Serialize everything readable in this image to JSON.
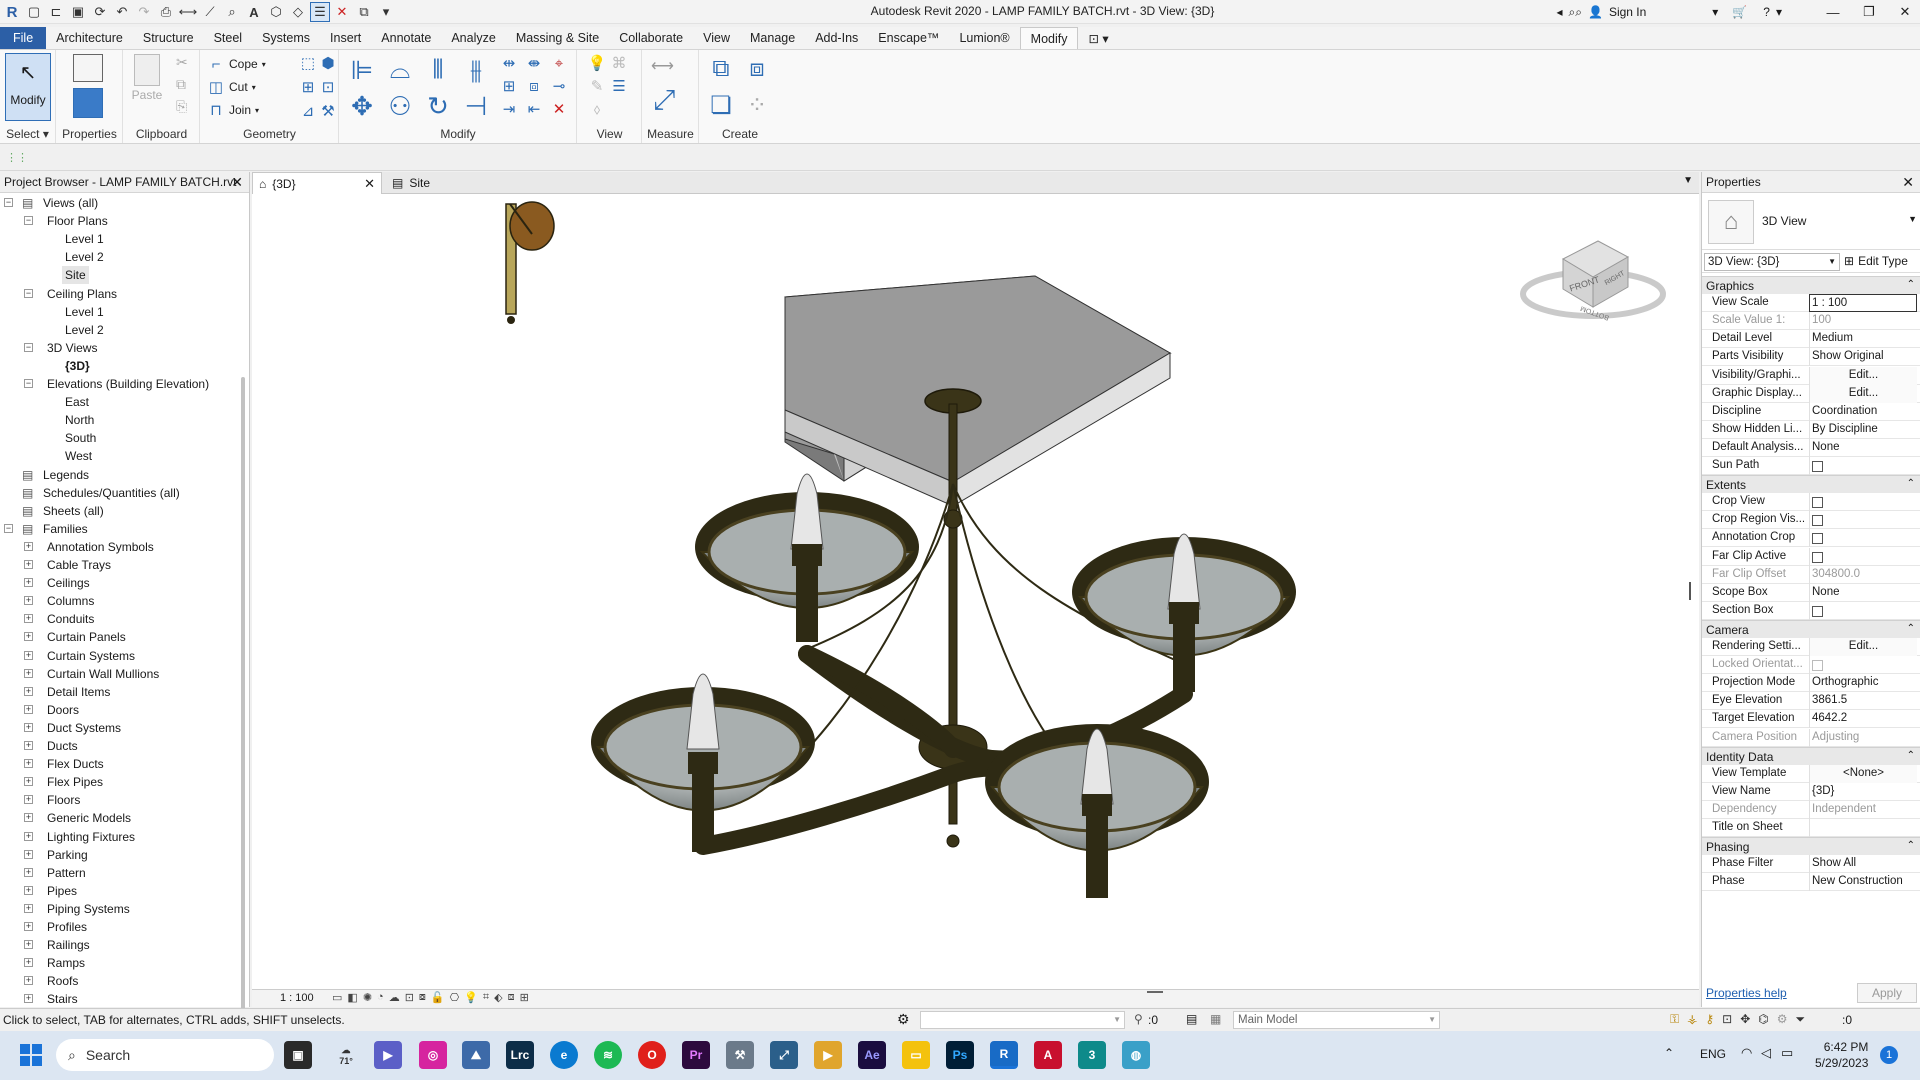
{
  "app": {
    "title": "Autodesk Revit 2020 - LAMP FAMILY BATCH.rvt - 3D View: {3D}",
    "sign_in": "Sign In",
    "logo": "R"
  },
  "ribbon_tabs": [
    "File",
    "Architecture",
    "Structure",
    "Steel",
    "Systems",
    "Insert",
    "Annotate",
    "Analyze",
    "Massing & Site",
    "Collaborate",
    "View",
    "Manage",
    "Add-Ins",
    "Enscape™",
    "Lumion®",
    "Modify"
  ],
  "active_tab": "Modify",
  "ribbon": {
    "select": {
      "button": "Modify",
      "label": "Select"
    },
    "properties": {
      "button": "",
      "label": "Properties"
    },
    "clipboard": {
      "paste": "Paste",
      "label": "Clipboard"
    },
    "geometry": {
      "cope": "Cope",
      "cut": "Cut",
      "join": "Join",
      "label": "Geometry"
    },
    "modify": {
      "label": "Modify"
    },
    "view": {
      "label": "View"
    },
    "measure": {
      "label": "Measure"
    },
    "create": {
      "label": "Create"
    }
  },
  "project_browser": {
    "title": "Project Browser - LAMP FAMILY BATCH.rvt",
    "tree": [
      {
        "level": 0,
        "label": "Views (all)",
        "toggle": "-"
      },
      {
        "level": 1,
        "label": "Floor Plans",
        "toggle": "-"
      },
      {
        "level": 2,
        "label": "Level 1"
      },
      {
        "level": 2,
        "label": "Level 2"
      },
      {
        "level": 2,
        "label": "Site",
        "selected": true
      },
      {
        "level": 1,
        "label": "Ceiling Plans",
        "toggle": "-"
      },
      {
        "level": 2,
        "label": "Level 1"
      },
      {
        "level": 2,
        "label": "Level 2"
      },
      {
        "level": 1,
        "label": "3D Views",
        "toggle": "-"
      },
      {
        "level": 2,
        "label": "{3D}",
        "bold": true
      },
      {
        "level": 1,
        "label": "Elevations (Building Elevation)",
        "toggle": "-"
      },
      {
        "level": 2,
        "label": "East"
      },
      {
        "level": 2,
        "label": "North"
      },
      {
        "level": 2,
        "label": "South"
      },
      {
        "level": 2,
        "label": "West"
      },
      {
        "level": 0,
        "label": "Legends"
      },
      {
        "level": 0,
        "label": "Schedules/Quantities (all)"
      },
      {
        "level": 0,
        "label": "Sheets (all)"
      },
      {
        "level": 0,
        "label": "Families",
        "toggle": "-"
      },
      {
        "level": 1,
        "label": "Annotation Symbols",
        "toggle": "+"
      },
      {
        "level": 1,
        "label": "Cable Trays",
        "toggle": "+"
      },
      {
        "level": 1,
        "label": "Ceilings",
        "toggle": "+"
      },
      {
        "level": 1,
        "label": "Columns",
        "toggle": "+"
      },
      {
        "level": 1,
        "label": "Conduits",
        "toggle": "+"
      },
      {
        "level": 1,
        "label": "Curtain Panels",
        "toggle": "+"
      },
      {
        "level": 1,
        "label": "Curtain Systems",
        "toggle": "+"
      },
      {
        "level": 1,
        "label": "Curtain Wall Mullions",
        "toggle": "+"
      },
      {
        "level": 1,
        "label": "Detail Items",
        "toggle": "+"
      },
      {
        "level": 1,
        "label": "Doors",
        "toggle": "+"
      },
      {
        "level": 1,
        "label": "Duct Systems",
        "toggle": "+"
      },
      {
        "level": 1,
        "label": "Ducts",
        "toggle": "+"
      },
      {
        "level": 1,
        "label": "Flex Ducts",
        "toggle": "+"
      },
      {
        "level": 1,
        "label": "Flex Pipes",
        "toggle": "+"
      },
      {
        "level": 1,
        "label": "Floors",
        "toggle": "+"
      },
      {
        "level": 1,
        "label": "Generic Models",
        "toggle": "+"
      },
      {
        "level": 1,
        "label": "Lighting Fixtures",
        "toggle": "+"
      },
      {
        "level": 1,
        "label": "Parking",
        "toggle": "+"
      },
      {
        "level": 1,
        "label": "Pattern",
        "toggle": "+"
      },
      {
        "level": 1,
        "label": "Pipes",
        "toggle": "+"
      },
      {
        "level": 1,
        "label": "Piping Systems",
        "toggle": "+"
      },
      {
        "level": 1,
        "label": "Profiles",
        "toggle": "+"
      },
      {
        "level": 1,
        "label": "Railings",
        "toggle": "+"
      },
      {
        "level": 1,
        "label": "Ramps",
        "toggle": "+"
      },
      {
        "level": 1,
        "label": "Roofs",
        "toggle": "+"
      },
      {
        "level": 1,
        "label": "Stairs",
        "toggle": "+"
      }
    ]
  },
  "view_tabs": [
    {
      "label": "{3D}",
      "active": true
    },
    {
      "label": "Site",
      "active": false
    }
  ],
  "viewcube": {
    "front": "FRONT",
    "side": "RIGHT",
    "bottom": "BOTTOM"
  },
  "view_control_bar": {
    "scale": "1 : 100"
  },
  "properties": {
    "title": "Properties",
    "type_name": "3D View",
    "selector": "3D View: {3D}",
    "edit_type": "Edit Type",
    "sections": [
      {
        "name": "Graphics",
        "rows": [
          {
            "k": "View Scale",
            "v": "1 : 100",
            "input": true
          },
          {
            "k": "Scale Value   1:",
            "v": "100",
            "disabled": true
          },
          {
            "k": "Detail Level",
            "v": "Medium"
          },
          {
            "k": "Parts Visibility",
            "v": "Show Original"
          },
          {
            "k": "Visibility/Graphi...",
            "v": "Edit...",
            "button": true
          },
          {
            "k": "Graphic Display...",
            "v": "Edit...",
            "button": true
          },
          {
            "k": "Discipline",
            "v": "Coordination"
          },
          {
            "k": "Show Hidden Li...",
            "v": "By Discipline"
          },
          {
            "k": "Default Analysis...",
            "v": "None"
          },
          {
            "k": "Sun Path",
            "v": "",
            "checkbox": true
          }
        ]
      },
      {
        "name": "Extents",
        "rows": [
          {
            "k": "Crop View",
            "v": "",
            "checkbox": true
          },
          {
            "k": "Crop Region Vis...",
            "v": "",
            "checkbox": true
          },
          {
            "k": "Annotation Crop",
            "v": "",
            "checkbox": true
          },
          {
            "k": "Far Clip Active",
            "v": "",
            "checkbox": true
          },
          {
            "k": "Far Clip Offset",
            "v": "304800.0",
            "disabled": true
          },
          {
            "k": "Scope Box",
            "v": "None"
          },
          {
            "k": "Section Box",
            "v": "",
            "checkbox": true
          }
        ]
      },
      {
        "name": "Camera",
        "rows": [
          {
            "k": "Rendering Setti...",
            "v": "Edit...",
            "button": true
          },
          {
            "k": "Locked Orientat...",
            "v": "",
            "checkbox": true,
            "disabled": true
          },
          {
            "k": "Projection Mode",
            "v": "Orthographic"
          },
          {
            "k": "Eye Elevation",
            "v": "3861.5"
          },
          {
            "k": "Target Elevation",
            "v": "4642.2"
          },
          {
            "k": "Camera Position",
            "v": "Adjusting",
            "disabled": true
          }
        ]
      },
      {
        "name": "Identity Data",
        "rows": [
          {
            "k": "View Template",
            "v": "<None>",
            "button": true
          },
          {
            "k": "View Name",
            "v": "{3D}"
          },
          {
            "k": "Dependency",
            "v": "Independent",
            "disabled": true
          },
          {
            "k": "Title on Sheet",
            "v": ""
          }
        ]
      },
      {
        "name": "Phasing",
        "rows": [
          {
            "k": "Phase Filter",
            "v": "Show All"
          },
          {
            "k": "Phase",
            "v": "New Construction"
          }
        ]
      }
    ],
    "help": "Properties help",
    "apply": "Apply"
  },
  "status_bar": {
    "message": "Click to select, TAB for alternates, CTRL adds, SHIFT unselects.",
    "count": ":0",
    "model": "Main Model",
    "filter": ":0"
  },
  "taskbar": {
    "search": "Search",
    "weather": "71°",
    "language": "ENG",
    "time": "6:42 PM",
    "date": "5/29/2023",
    "notifications": "1"
  },
  "colors": {
    "file_tab": "#2c5fa6",
    "fixture_bronze": "#2e2a14",
    "canopy": "#9b9b9b"
  }
}
